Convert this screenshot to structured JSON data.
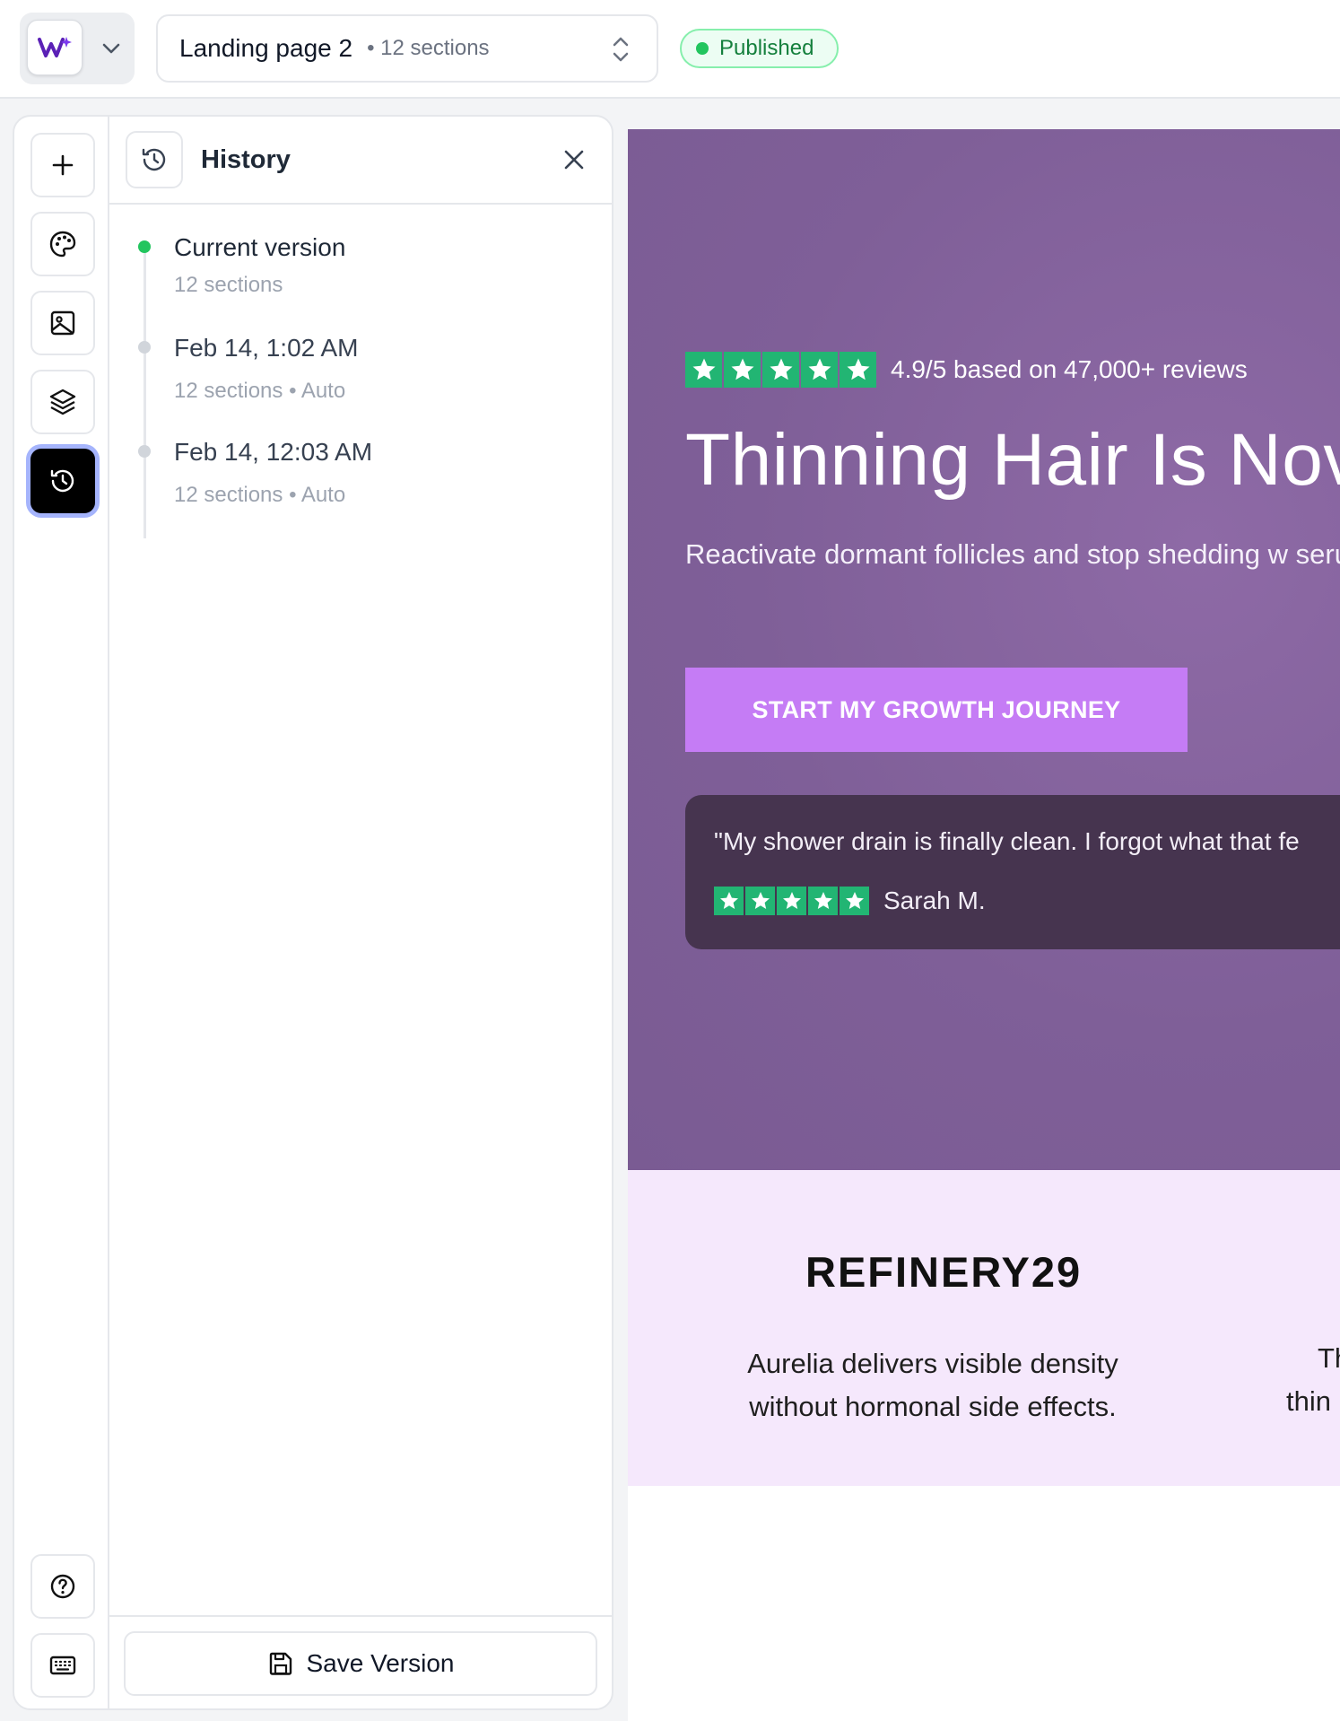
{
  "topbar": {
    "page_name": "Landing page 2",
    "page_meta": "• 12 sections",
    "status": "Published",
    "status_color": "#22c55e",
    "icons": [
      "logo-icon",
      "chevron-down-icon",
      "chevron-up-down-icon"
    ]
  },
  "rail": {
    "items": [
      {
        "name": "add",
        "icon": "plus-icon"
      },
      {
        "name": "theme",
        "icon": "palette-icon"
      },
      {
        "name": "media",
        "icon": "image-icon"
      },
      {
        "name": "layers",
        "icon": "layers-icon"
      },
      {
        "name": "history",
        "icon": "history-icon",
        "active": true
      }
    ],
    "bottom_items": [
      {
        "name": "help",
        "icon": "help-icon"
      },
      {
        "name": "shortcuts",
        "icon": "keyboard-icon"
      }
    ]
  },
  "history": {
    "title": "History",
    "versions": [
      {
        "title": "Current version",
        "sub": "12 sections"
      },
      {
        "title": "Feb 14, 1:02 AM",
        "sub": "12 sections • Auto"
      },
      {
        "title": "Feb 14, 12:03 AM",
        "sub": "12 sections • Auto"
      }
    ],
    "save_label": "Save Version"
  },
  "preview": {
    "rating_text": "4.9/5 based on 47,000+ reviews",
    "rating_stars": 5,
    "hero_title": "Thinning Hair Is Nov",
    "hero_sub": "Reactivate dormant follicles and stop shedding w serum.",
    "cta_label": "START MY GROWTH JOURNEY",
    "quote": "\"My shower drain is finally clean. I forgot what that fe",
    "reviewer": "Sarah M.",
    "press_logo": "REFINERY29",
    "press_quote": "Aurelia delivers visible density without hormonal side effects.",
    "press_quote_2_line1": "Th",
    "press_quote_2_line2": "thin",
    "colors": {
      "hero_bg": "#7f5f98",
      "cta_bg": "#c57cf5",
      "star_bg": "#22b573",
      "testimonial_bg": "#46344f",
      "press_bg": "#f5e8fc"
    }
  }
}
